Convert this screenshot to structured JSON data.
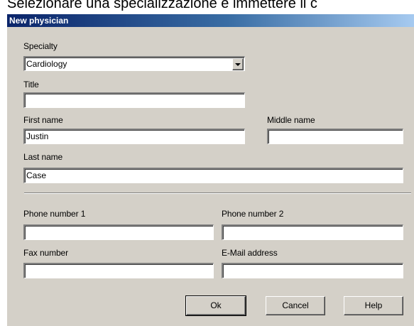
{
  "background_caption": "Selezionare una specializzazione e immettere il c",
  "window": {
    "title": "New physician"
  },
  "form": {
    "specialty": {
      "label": "Specialty",
      "value": "Cardiology"
    },
    "title": {
      "label": "Title",
      "value": ""
    },
    "first_name": {
      "label": "First name",
      "value": "Justin"
    },
    "middle_name": {
      "label": "Middle name",
      "value": ""
    },
    "last_name": {
      "label": "Last name",
      "value": "Case"
    },
    "phone1": {
      "label": "Phone number 1",
      "value": ""
    },
    "phone2": {
      "label": "Phone number 2",
      "value": ""
    },
    "fax": {
      "label": "Fax number",
      "value": ""
    },
    "email": {
      "label": "E-Mail address",
      "value": ""
    }
  },
  "buttons": {
    "ok": "Ok",
    "cancel": "Cancel",
    "help": "Help"
  },
  "icons": {
    "dropdown": "chevron-down-icon"
  },
  "colors": {
    "dialog_bg": "#d4d0c8",
    "titlebar_start": "#0a246a",
    "titlebar_end": "#a6caf0"
  }
}
